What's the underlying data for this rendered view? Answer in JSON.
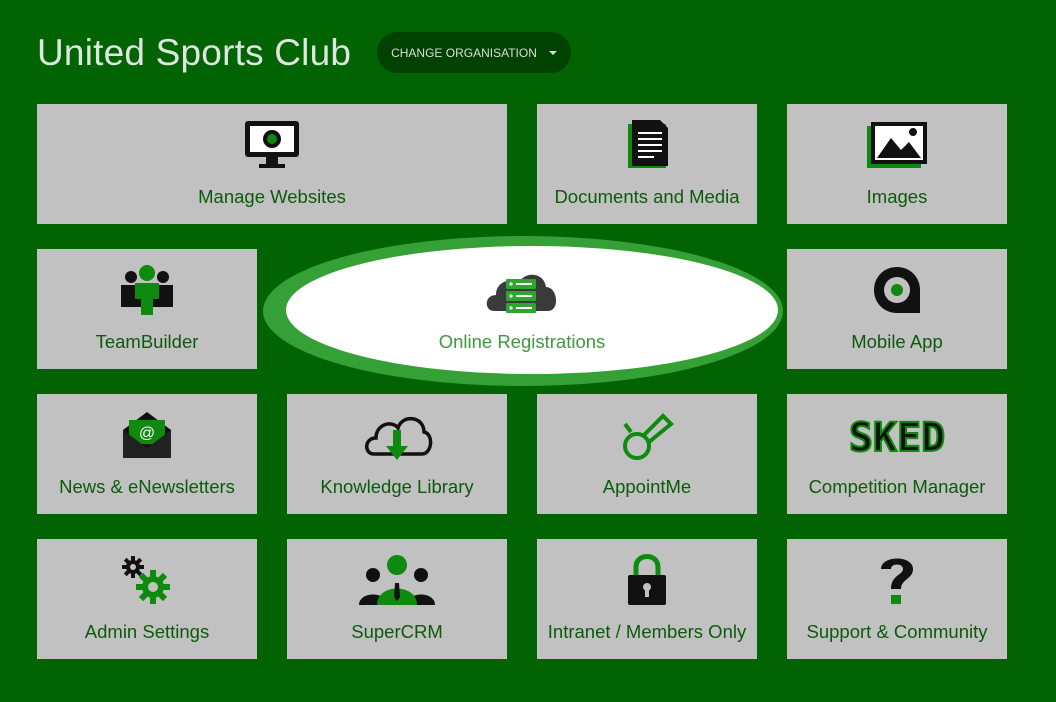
{
  "header": {
    "title": "United Sports Club",
    "change_org_label": "CHANGE ORGANISATION"
  },
  "colors": {
    "background": "#026302",
    "tile": "#c1c1c1",
    "label": "#0c5a0c",
    "accent": "#0e8a0e",
    "highlight": "#35a035"
  },
  "tiles": [
    {
      "label": "Manage Websites",
      "icon": "monitor-icon"
    },
    {
      "label": "Documents and Media",
      "icon": "document-icon"
    },
    {
      "label": "Images",
      "icon": "image-icon"
    },
    {
      "label": "TeamBuilder",
      "icon": "team-icon"
    },
    {
      "label": "Online Registrations",
      "icon": "cloud-server-icon"
    },
    {
      "label": "Mobile App",
      "icon": "map-pin-icon"
    },
    {
      "label": "News & eNewsletters",
      "icon": "envelope-icon"
    },
    {
      "label": "Knowledge Library",
      "icon": "cloud-download-icon"
    },
    {
      "label": "AppointMe",
      "icon": "whistle-icon"
    },
    {
      "label": "Competition Manager",
      "icon": "sked-logo-icon",
      "icon_text": "SKED"
    },
    {
      "label": "Admin Settings",
      "icon": "gears-icon"
    },
    {
      "label": "SuperCRM",
      "icon": "people-icon"
    },
    {
      "label": "Intranet / Members Only",
      "icon": "lock-icon"
    },
    {
      "label": "Support & Community",
      "icon": "question-icon"
    }
  ]
}
